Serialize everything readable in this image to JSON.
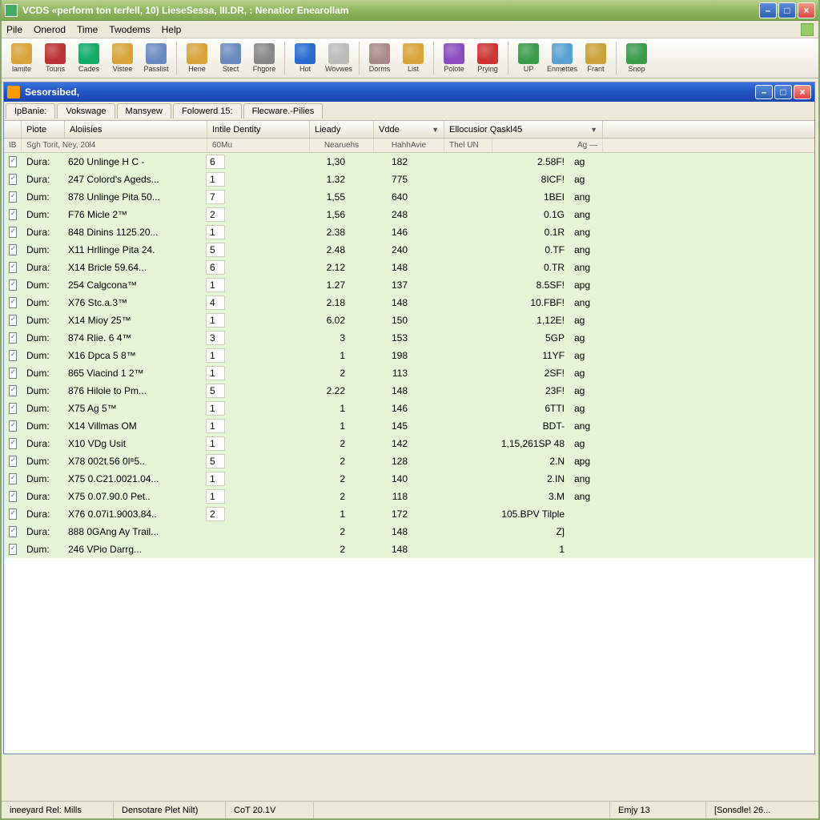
{
  "window": {
    "title": "VCDS «perform ton terfell, 10) LieseSessa, III.DR, : Nenatior Enearollam"
  },
  "menubar": [
    "Pile",
    "Onerod",
    "Time",
    "Twodems",
    "Help"
  ],
  "toolbar": {
    "groups": [
      [
        {
          "label": "lamite",
          "color": "#d8a43a"
        },
        {
          "label": "Touns",
          "color": "#b33"
        },
        {
          "label": "Cades",
          "color": "#1a6"
        },
        {
          "label": "Vistee",
          "color": "#d8a43a"
        },
        {
          "label": "Passlist",
          "color": "#6a8bbf"
        }
      ],
      [
        {
          "label": "Hene",
          "color": "#d8a43a"
        },
        {
          "label": "Stect",
          "color": "#6a8bbf"
        },
        {
          "label": "Fhgore",
          "color": "#888"
        }
      ],
      [
        {
          "label": "Hot",
          "color": "#2a6bd0"
        },
        {
          "label": "Wovwes",
          "color": "#bbb"
        }
      ],
      [
        {
          "label": "Dorms",
          "color": "#a88"
        },
        {
          "label": "List",
          "color": "#d8a43a"
        }
      ],
      [
        {
          "label": "Polote",
          "color": "#8a4bc0"
        },
        {
          "label": "Prying",
          "color": "#c33"
        }
      ],
      [
        {
          "label": "UP",
          "color": "#3a9b4a"
        },
        {
          "label": "Enmettes",
          "color": "#5aa0d0"
        },
        {
          "label": "Frant",
          "color": "#caa13a"
        }
      ],
      [
        {
          "label": "Snop",
          "color": "#3a9b4a"
        }
      ]
    ]
  },
  "child": {
    "title": "Sesorsibed,"
  },
  "tabs": [
    "IpBanie:",
    "Vokswage",
    "Mansyew",
    "Folowerd 15:",
    "Flecware.-Pilies"
  ],
  "table": {
    "headers": [
      {
        "label": "Piote",
        "dd": false
      },
      {
        "label": "Aloiisies",
        "dd": false
      },
      {
        "label": "Intile Dentity",
        "dd": false
      },
      {
        "label": "Lieady",
        "dd": false
      },
      {
        "label": "Vdde",
        "dd": true
      },
      {
        "label": "Ellocusior Qaskl45",
        "dd": true
      }
    ],
    "subheaders": [
      "IB",
      "Sgh Torit, Ney, 20l4",
      "60Mu",
      "Nearuehs",
      "HahhAvie",
      "Thel  UN",
      "Ag  —"
    ],
    "rows": [
      {
        "p": "Dura:",
        "d": "620 Unlinge H C -",
        "n": "6",
        "ld": "1,30",
        "vd": "182",
        "eq": "2.58F!",
        "u": "ag"
      },
      {
        "p": "Dura:",
        "d": "247 Colord's Ageds...",
        "n": "1",
        "ld": "1.32",
        "vd": "775",
        "eq": "8ICF!",
        "u": "ag"
      },
      {
        "p": "Dum:",
        "d": "878 Unlinge Pita 50...",
        "n": "7",
        "ld": "1,55",
        "vd": "640",
        "eq": "1BEI",
        "u": "ang"
      },
      {
        "p": "Dum:",
        "d": "F76 Micle 2™",
        "n": "2",
        "ld": "1,56",
        "vd": "248",
        "eq": "0.1G",
        "u": "ang"
      },
      {
        "p": "Dura:",
        "d": "848 Dinins 1125.20...",
        "n": "1",
        "ld": "2.38",
        "vd": "146",
        "eq": "0.1R",
        "u": "ang"
      },
      {
        "p": "Dum:",
        "d": "X11 Hrllinge Pita 24.",
        "n": "5",
        "ld": "2.48",
        "vd": "240",
        "eq": "0.TF",
        "u": "ang"
      },
      {
        "p": "Dura:",
        "d": "X14 Bricle 59.64...",
        "n": "6",
        "ld": "2.12",
        "vd": "148",
        "eq": "0.TR",
        "u": "ang"
      },
      {
        "p": "Dum:",
        "d": "254 Calgcona™",
        "n": "1",
        "ld": "1.27",
        "vd": "137",
        "eq": "8.5SF!",
        "u": "apg"
      },
      {
        "p": "Dum:",
        "d": "X76 Stc.a.3™",
        "n": "4",
        "ld": "2.18",
        "vd": "148",
        "eq": "10.FBF!",
        "u": "ang"
      },
      {
        "p": "Dum:",
        "d": "X14 Mioy 25™",
        "n": "1",
        "ld": "6.02",
        "vd": "150",
        "eq": "1,12E!",
        "u": "ag"
      },
      {
        "p": "Dum:",
        "d": "874 Rlie. 6 4™",
        "n": "3",
        "ld": "3",
        "vd": "153",
        "eq": "5GP",
        "u": "ag"
      },
      {
        "p": "Dum:",
        "d": "X16 Dpca 5 8™",
        "n": "1",
        "ld": "1",
        "vd": "198",
        "eq": "11YF",
        "u": "ag"
      },
      {
        "p": "Dum:",
        "d": "865 Viacind 1 2™",
        "n": "1",
        "ld": "2",
        "vd": "113",
        "eq": "2SF!",
        "u": "ag"
      },
      {
        "p": "Dum:",
        "d": "876 Hilole to Pm...",
        "n": "5",
        "ld": "2.22",
        "vd": "148",
        "eq": "23F!",
        "u": "ag"
      },
      {
        "p": "Dum:",
        "d": "X75 Ag 5™",
        "n": "1",
        "ld": "1",
        "vd": "146",
        "eq": "6TTI",
        "u": "ag"
      },
      {
        "p": "Dum:",
        "d": "X14 Villmas OM",
        "n": "1",
        "ld": "1",
        "vd": "145",
        "eq": "BDT-",
        "u": "ang"
      },
      {
        "p": "Dura:",
        "d": "X10 VDg Usit",
        "n": "1",
        "ld": "2",
        "vd": "142",
        "eq": "1,15,261SP 48",
        "u": "ag"
      },
      {
        "p": "Dum:",
        "d": "X78 002t.56 0l⁸5..",
        "n": "5",
        "ld": "2",
        "vd": "128",
        "eq": "2.N",
        "u": "apg"
      },
      {
        "p": "Dum:",
        "d": "X75 0.C21.0021.04...",
        "n": "1",
        "ld": "2",
        "vd": "140",
        "eq": "2.IN",
        "u": "ang"
      },
      {
        "p": "Dura:",
        "d": "X75 0.07.90.0 Pet..",
        "n": "1",
        "ld": "2",
        "vd": "118",
        "eq": "3.M",
        "u": "ang"
      },
      {
        "p": "Dura:",
        "d": "X76 0.07i1.9003.84..",
        "n": "2",
        "ld": "1",
        "vd": "172",
        "eq": "105.BPV Tilple",
        "u": ""
      },
      {
        "p": "Dura:",
        "d": "888 0GAng Ay Trail...",
        "n": "",
        "ld": "2",
        "vd": "148",
        "eq": "Z]",
        "u": ""
      },
      {
        "p": "Dum:",
        "d": "246 VPio Darrg...",
        "n": "",
        "ld": "2",
        "vd": "148",
        "eq": "1",
        "u": ""
      }
    ]
  },
  "statusbar": [
    "ineeyard Rel: Mills",
    "Densotare Plet Nilt)",
    "CoT 20.1V",
    "",
    "Emjy 13",
    "[Sonsdle! 26..."
  ]
}
